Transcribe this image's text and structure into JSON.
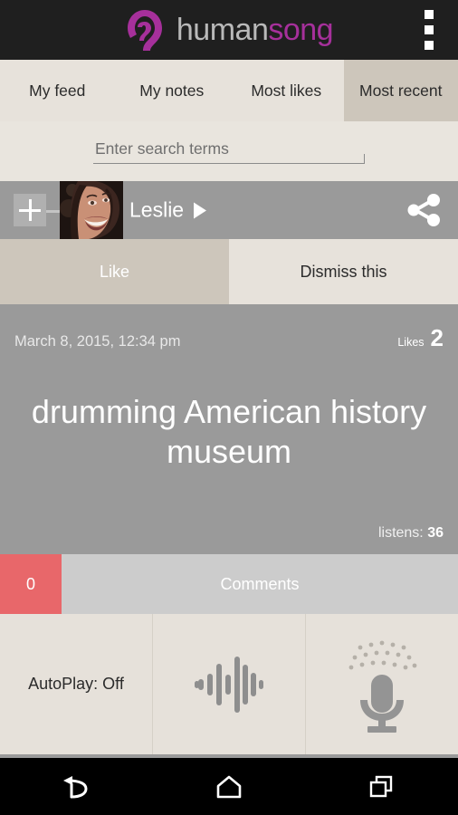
{
  "header": {
    "brand_human": "human",
    "brand_song": "song",
    "overflow_label": "More options",
    "bg_color": "#1f1f1f",
    "accent_color": "#a6309b"
  },
  "tabs": [
    {
      "label": "My feed",
      "active": false
    },
    {
      "label": "My notes",
      "active": false
    },
    {
      "label": "Most likes",
      "active": false
    },
    {
      "label": "Most recent",
      "active": true
    }
  ],
  "search": {
    "placeholder": "Enter search terms",
    "value": ""
  },
  "user_row": {
    "add_label": "+",
    "username": "Leslie",
    "play_label": "Play",
    "share_label": "Share"
  },
  "actions": {
    "like_label": "Like",
    "dismiss_label": "Dismiss this"
  },
  "post": {
    "date": "March 8, 2015, 12:34 pm",
    "likes_label": "Likes",
    "likes_count": "2",
    "title": "drumming American history museum",
    "listens_label": "listens:",
    "listens_count": "36"
  },
  "comments": {
    "count": "0",
    "label": "Comments",
    "badge_color": "#e8676a"
  },
  "controls": {
    "autoplay_label": "AutoPlay: Off",
    "waveform_label": "Play waveform",
    "record_label": "Record"
  },
  "navbar": {
    "back_label": "Back",
    "home_label": "Home",
    "recents_label": "Recent apps"
  }
}
